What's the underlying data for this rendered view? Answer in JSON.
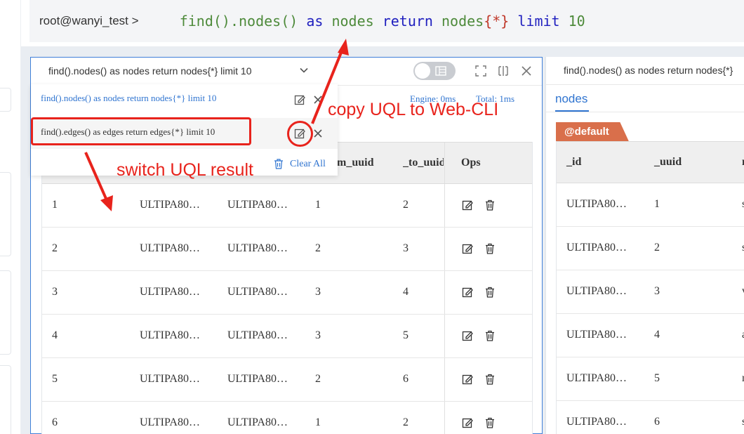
{
  "cli": {
    "prompt": "root@wanyi_test >",
    "tokens": [
      {
        "text": "find().nodes()",
        "kind": "fn"
      },
      {
        "text": " as ",
        "kind": "kw"
      },
      {
        "text": "nodes",
        "kind": "fn"
      },
      {
        "text": " return ",
        "kind": "kw"
      },
      {
        "text": "nodes",
        "kind": "fn"
      },
      {
        "text": "{*}",
        "kind": "br"
      },
      {
        "text": " limit ",
        "kind": "kw"
      },
      {
        "text": "10",
        "kind": "fn"
      }
    ]
  },
  "left_panel": {
    "title": "find().nodes() as nodes return nodes{*} limit 10",
    "engine": "Engine: 0ms",
    "total": "Total: 1ms",
    "history": {
      "items": [
        {
          "text": "find().nodes() as nodes return nodes{*} limit 10",
          "active": true
        },
        {
          "text": "find().edges() as edges return edges{*} limit 10",
          "active": false
        }
      ],
      "clear_label": "Clear All"
    },
    "columns": [
      "",
      "",
      "",
      "m_uuid",
      "_to_uuid",
      "Ops"
    ],
    "rows": [
      [
        "1",
        "ULTIPA80…",
        "ULTIPA80…",
        "1",
        "2"
      ],
      [
        "2",
        "ULTIPA80…",
        "ULTIPA80…",
        "2",
        "3"
      ],
      [
        "3",
        "ULTIPA80…",
        "ULTIPA80…",
        "3",
        "4"
      ],
      [
        "4",
        "ULTIPA80…",
        "ULTIPA80…",
        "3",
        "5"
      ],
      [
        "5",
        "ULTIPA80…",
        "ULTIPA80…",
        "2",
        "6"
      ],
      [
        "6",
        "ULTIPA80…",
        "ULTIPA80…",
        "1",
        "2"
      ]
    ]
  },
  "right_panel": {
    "title": "find().nodes() as nodes return nodes{*}",
    "tab": "nodes",
    "schema_tag": "@default",
    "columns": [
      "_id",
      "_uuid",
      "n"
    ],
    "rows": [
      [
        "ULTIPA80…",
        "1",
        "s"
      ],
      [
        "ULTIPA80…",
        "2",
        "s"
      ],
      [
        "ULTIPA80…",
        "3",
        "v"
      ],
      [
        "ULTIPA80…",
        "4",
        "a"
      ],
      [
        "ULTIPA80…",
        "5",
        "r"
      ],
      [
        "ULTIPA80…",
        "6",
        "s"
      ]
    ]
  },
  "annotations": {
    "copy_label": "copy UQL to Web-CLI",
    "switch_label": "switch UQL result",
    "color": "#e8231c"
  },
  "colors": {
    "accent": "#2f74d0",
    "tag": "#d96f4b",
    "keyword": "#1f1fbf",
    "function": "#4d8a3a"
  },
  "icons": [
    "chevron-down-icon",
    "table-view-icon",
    "fullscreen-icon",
    "split-icon",
    "close-icon",
    "edit-icon",
    "delete-icon",
    "trash-icon"
  ]
}
